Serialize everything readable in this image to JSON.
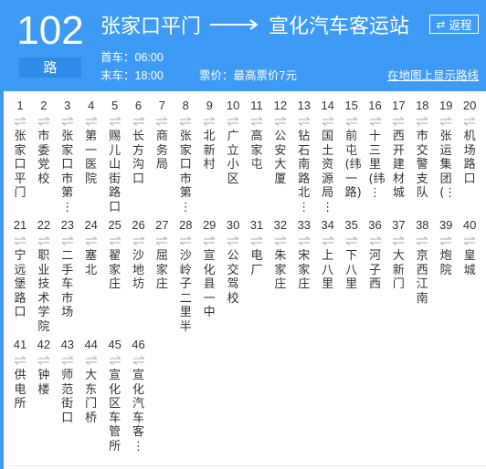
{
  "header": {
    "route_number": "102",
    "route_suffix": "路",
    "from": "张家口平门",
    "to": "宣化汽车客运站",
    "first_bus": "首车：06:00",
    "last_bus": "末车：18:00",
    "fare": "票价：最高票价7元",
    "return_button": {
      "icon": "swap-icon",
      "label": "返程"
    },
    "map_link": "在地图上显示路线"
  },
  "colors": {
    "accent": "#3d9bf5",
    "text": "#333333"
  },
  "stations": [
    {
      "num": "1",
      "name": "张家口平门"
    },
    {
      "num": "2",
      "name": "市委党校"
    },
    {
      "num": "3",
      "name": "张家口市第⋮"
    },
    {
      "num": "4",
      "name": "第一医院"
    },
    {
      "num": "5",
      "name": "赐儿山街路口"
    },
    {
      "num": "6",
      "name": "长方沟口"
    },
    {
      "num": "7",
      "name": "商务局"
    },
    {
      "num": "8",
      "name": "张家口市第⋮"
    },
    {
      "num": "9",
      "name": "北新村"
    },
    {
      "num": "10",
      "name": "广立小区"
    },
    {
      "num": "11",
      "name": "高家屯"
    },
    {
      "num": "12",
      "name": "公安大厦"
    },
    {
      "num": "13",
      "name": "钻石南路北⋮"
    },
    {
      "num": "14",
      "name": "国土资源局⋮"
    },
    {
      "num": "15",
      "name": "前屯(纬一路)"
    },
    {
      "num": "16",
      "name": "十三里(纬⋮"
    },
    {
      "num": "17",
      "name": "西开建材城"
    },
    {
      "num": "18",
      "name": "市交警支队"
    },
    {
      "num": "19",
      "name": "张运集团(⋮"
    },
    {
      "num": "20",
      "name": "机场路口"
    },
    {
      "num": "21",
      "name": "宁远堡路口"
    },
    {
      "num": "22",
      "name": "职业技术学院"
    },
    {
      "num": "23",
      "name": "二手车市场"
    },
    {
      "num": "24",
      "name": "塞北"
    },
    {
      "num": "25",
      "name": "翟家庄"
    },
    {
      "num": "26",
      "name": "沙地坊"
    },
    {
      "num": "27",
      "name": "屈家庄"
    },
    {
      "num": "28",
      "name": "沙岭子二里半"
    },
    {
      "num": "29",
      "name": "宣化县一中"
    },
    {
      "num": "30",
      "name": "公交驾校"
    },
    {
      "num": "31",
      "name": "电厂"
    },
    {
      "num": "32",
      "name": "朱家庄"
    },
    {
      "num": "33",
      "name": "宋家庄"
    },
    {
      "num": "34",
      "name": "上八里"
    },
    {
      "num": "35",
      "name": "下八里"
    },
    {
      "num": "36",
      "name": "河子西"
    },
    {
      "num": "37",
      "name": "大新门"
    },
    {
      "num": "38",
      "name": "京西江南"
    },
    {
      "num": "39",
      "name": "炮院"
    },
    {
      "num": "40",
      "name": "皇城"
    },
    {
      "num": "41",
      "name": "供电所"
    },
    {
      "num": "42",
      "name": "钟楼"
    },
    {
      "num": "43",
      "name": "师范街口"
    },
    {
      "num": "44",
      "name": "大东门桥"
    },
    {
      "num": "45",
      "name": "宣化区车管所"
    },
    {
      "num": "46",
      "name": "宣化汽车客⋮"
    }
  ]
}
